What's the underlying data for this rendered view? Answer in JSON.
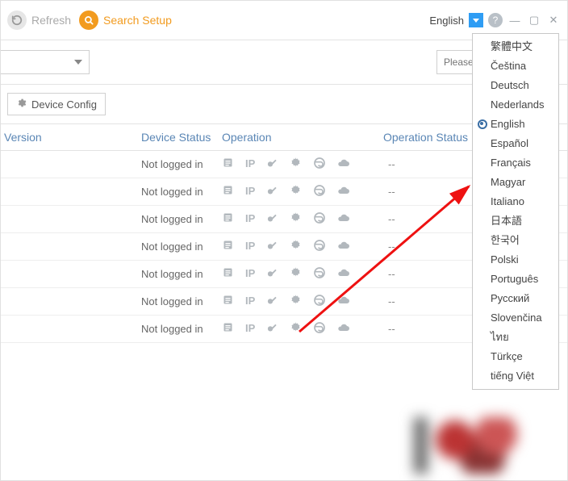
{
  "toolbar": {
    "refresh": "Refresh",
    "search_setup": "Search Setup",
    "language_label": "English"
  },
  "search": {
    "placeholder": "Please enter keywords"
  },
  "config": {
    "device_config": "Device Config"
  },
  "table": {
    "headers": {
      "version": "Version",
      "device_status": "Device Status",
      "operation": "Operation",
      "op_status": "Operation Status"
    },
    "rows": [
      {
        "status": "Not logged in",
        "op_status": "--"
      },
      {
        "status": "Not logged in",
        "op_status": "--"
      },
      {
        "status": "Not logged in",
        "op_status": "--"
      },
      {
        "status": "Not logged in",
        "op_status": "--"
      },
      {
        "status": "Not logged in",
        "op_status": "--"
      },
      {
        "status": "Not logged in",
        "op_status": "--"
      },
      {
        "status": "Not logged in",
        "op_status": "--"
      }
    ]
  },
  "lang_menu": {
    "selected": "English",
    "items": [
      "繁體中文",
      "Čeština",
      "Deutsch",
      "Nederlands",
      "English",
      "Español",
      "Français",
      "Magyar",
      "Italiano",
      "日本語",
      "한국어",
      "Polski",
      "Português",
      "Русский",
      "Slovenčina",
      "ไทย",
      "Türkçe",
      "tiếng Việt"
    ]
  }
}
